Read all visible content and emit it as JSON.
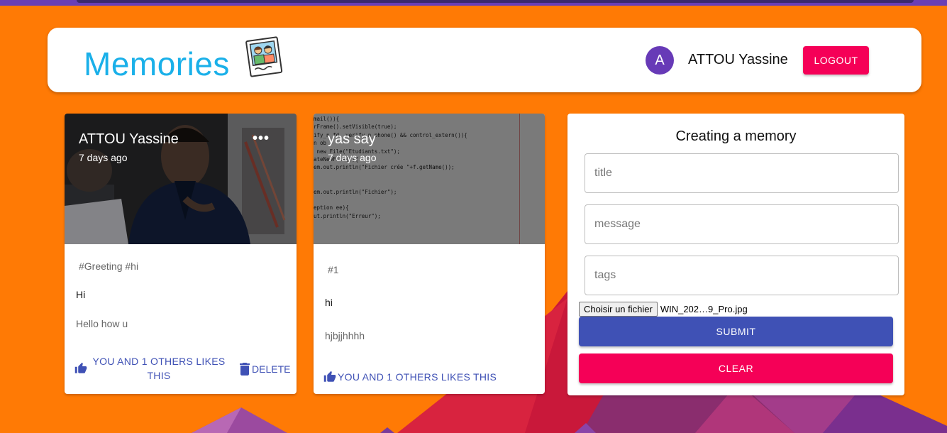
{
  "colors": {
    "background": "#ff7a05",
    "brand": "#1ab0e9",
    "primary": "#3f51b5",
    "secondary": "#f50057",
    "avatar": "#673ab7"
  },
  "header": {
    "brand": "Memories",
    "brand_icon": "photo-memories-icon",
    "avatar_letter": "A",
    "user_name": "ATTOU Yassine",
    "logout_label": "LOGOUT"
  },
  "posts": [
    {
      "author": "ATTOU Yassine",
      "time": "7 days ago",
      "more_label": "•••",
      "tags": "#Greeting #hi",
      "title": "Hi",
      "message": "Hello how u",
      "like_label": "YOU AND 1 OTHERS LIKES THIS",
      "delete_label": "DELETE"
    },
    {
      "author": "yas say",
      "time": "7 days ago",
      "tags": "#1",
      "title": "hi",
      "message": "hjbjjhhhh",
      "like_label": "YOU AND 1 OTHERS LIKES THIS"
    }
  ],
  "code_lines": [
    "mail()){",
    "rFrame().setVisible(true);",
    "ify_n_fd  verify_n_phone() && control_extern()){",
    "n ob",
    " new File(\"Etudiants.txt\");",
    "ateNewFile()){",
    "em.out.println(\"Fichier crée \"+f.getName());",
    "",
    "",
    "em.out.println(\"Fichier\");",
    "",
    "eption ee){",
    "ut.println(\"Erreur\");"
  ],
  "form": {
    "title": "Creating a memory",
    "title_placeholder": "title",
    "message_placeholder": "message",
    "tags_placeholder": "tags",
    "file_button": "Choisir un fichier",
    "file_name": "WIN_202…9_Pro.jpg",
    "submit_label": "SUBMIT",
    "clear_label": "CLEAR"
  }
}
